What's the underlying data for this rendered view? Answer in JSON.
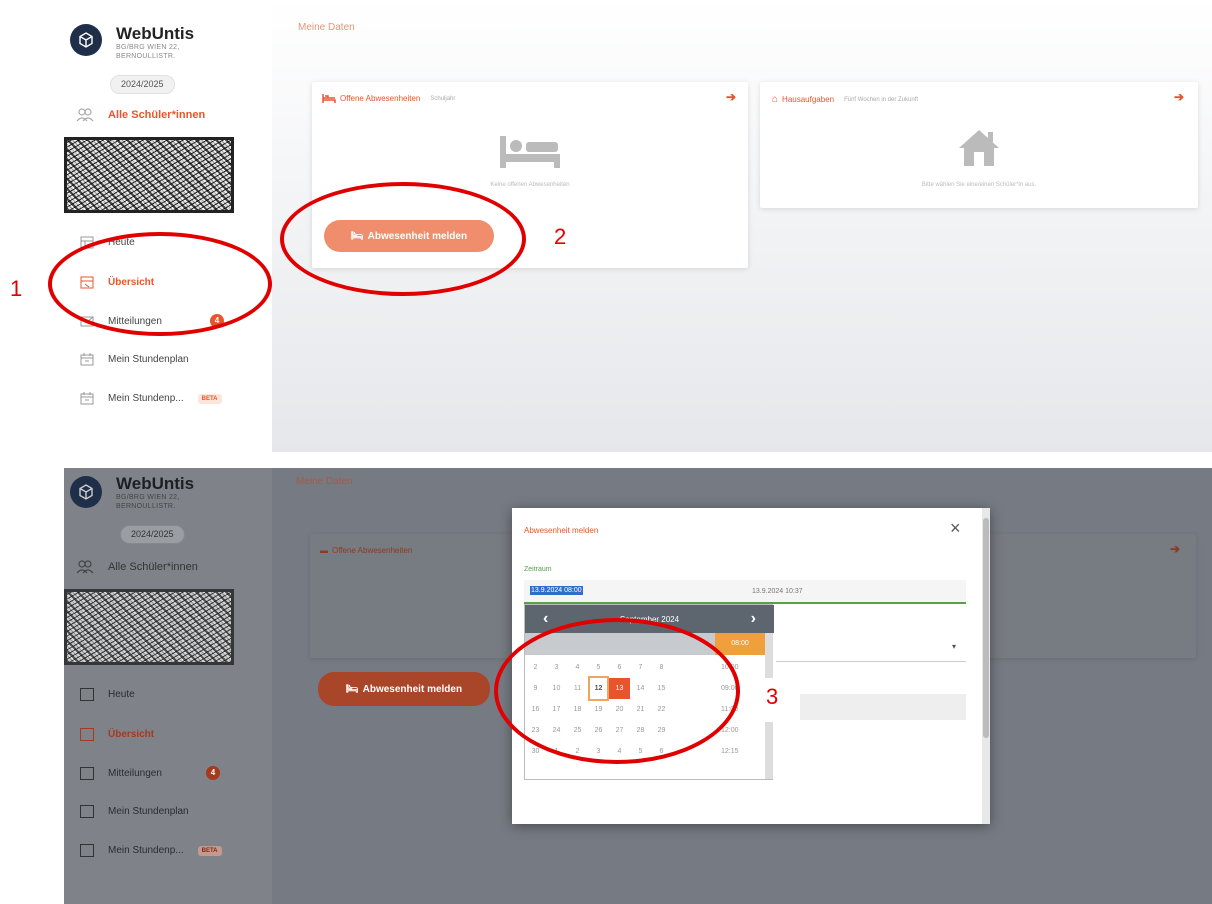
{
  "app": {
    "name": "WebUntis",
    "school": [
      "BG/BRG WIEN 22,",
      "BERNOULLISTR."
    ],
    "year": "2024/2025"
  },
  "sidebar": {
    "student": "Alle Schüler*innen",
    "items": [
      {
        "label": "Heute",
        "icon": "today-icon"
      },
      {
        "label": "Übersicht",
        "icon": "overview-icon"
      },
      {
        "label": "Mitteilungen",
        "icon": "mail-icon",
        "badge": "4"
      },
      {
        "label": "Mein Stundenplan",
        "icon": "calendar-icon"
      },
      {
        "label": "Mein Stundenp...",
        "icon": "calendar-icon",
        "tag": "BETA"
      }
    ]
  },
  "page": {
    "title": "Meine Daten"
  },
  "cards": {
    "absences": {
      "title": "Offene Abwesenheiten",
      "subtitle": "Schuljahr",
      "empty": "Keine offenen Abwesenheiten",
      "button": "Abwesenheit melden"
    },
    "homework": {
      "title": "Hausaufgaben",
      "subtitle": "Fünf Wochen in der Zukunft",
      "empty": "Bitte wählen Sie eine/einen Schüler*in aus."
    }
  },
  "annotations": {
    "step1": "1",
    "step2": "2",
    "step3": "3"
  },
  "modal": {
    "title": "Abwesenheit melden",
    "close": "×",
    "period_label": "Zeitraum",
    "start_value": "13.9.2024 08:00",
    "end_value": "13.9.2024 10:37",
    "datepicker": {
      "month": "September 2024",
      "prev": "‹",
      "next": "›",
      "selected_time": "08:00",
      "weeks": [
        [
          "2",
          "3",
          "4",
          "5",
          "6",
          "7",
          "8"
        ],
        [
          "9",
          "10",
          "11",
          "12",
          "13",
          "14",
          "15"
        ],
        [
          "16",
          "17",
          "18",
          "19",
          "20",
          "21",
          "22"
        ],
        [
          "23",
          "24",
          "25",
          "26",
          "27",
          "28",
          "29"
        ],
        [
          "30",
          "1",
          "2",
          "3",
          "4",
          "5",
          "6"
        ]
      ],
      "times": [
        "10:00",
        "09:00",
        "11:00",
        "12:00",
        "12:15"
      ]
    }
  },
  "colors": {
    "accent": "#e8552d",
    "button": "#ef8d6c",
    "navy": "#1f2f4a",
    "annotation": "#e00000"
  }
}
